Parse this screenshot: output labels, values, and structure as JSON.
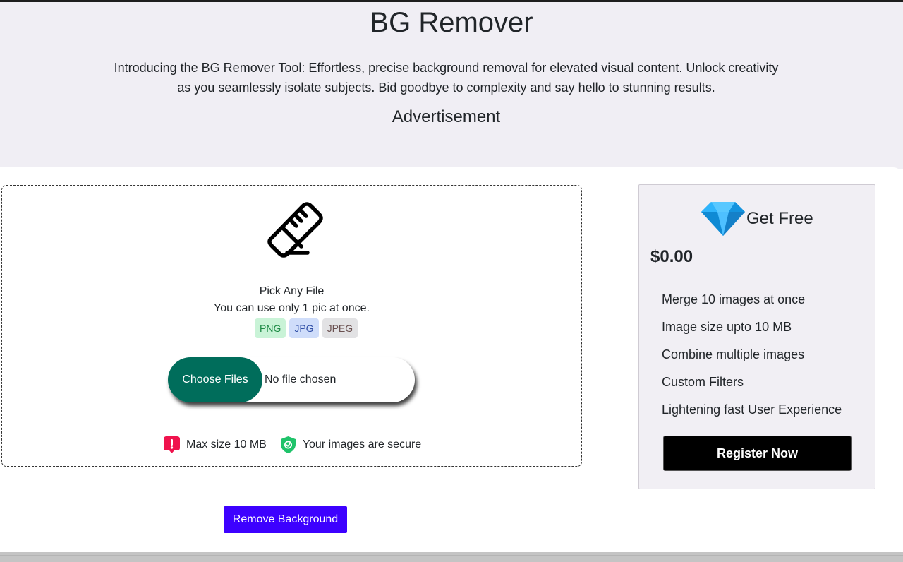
{
  "hero": {
    "title": "BG Remover",
    "intro": "Introducing the BG Remover Tool: Effortless, precise background removal for elevated visual content. Unlock creativity as you seamlessly isolate subjects. Bid goodbye to complexity and say hello to stunning results.",
    "ad_label": "Advertisement"
  },
  "upload": {
    "icon": "eraser-icon",
    "pick_label": "Pick Any File",
    "limit_text": "You can use only 1 pic at once.",
    "file_types": [
      "PNG",
      "JPG",
      "JPEG"
    ],
    "choose_button": "Choose Files",
    "file_status": "No file chosen",
    "max_size_note": "Max size 10 MB",
    "secure_note": "Your images are secure",
    "remove_button": "Remove Background"
  },
  "plan": {
    "icon": "diamond-icon",
    "title": "Get Free",
    "price": "$0.00",
    "features": [
      "Merge 10 images at once",
      "Image size upto 10 MB",
      "Combine multiple images",
      "Custom Filters",
      "Lightening fast User Experience"
    ],
    "cta": "Register Now"
  },
  "colors": {
    "hero_bg": "#f0eef4",
    "choose_btn": "#006d5b",
    "remove_btn": "#3d01ff",
    "register_btn": "#000000",
    "card_bg": "#f1eff4"
  }
}
